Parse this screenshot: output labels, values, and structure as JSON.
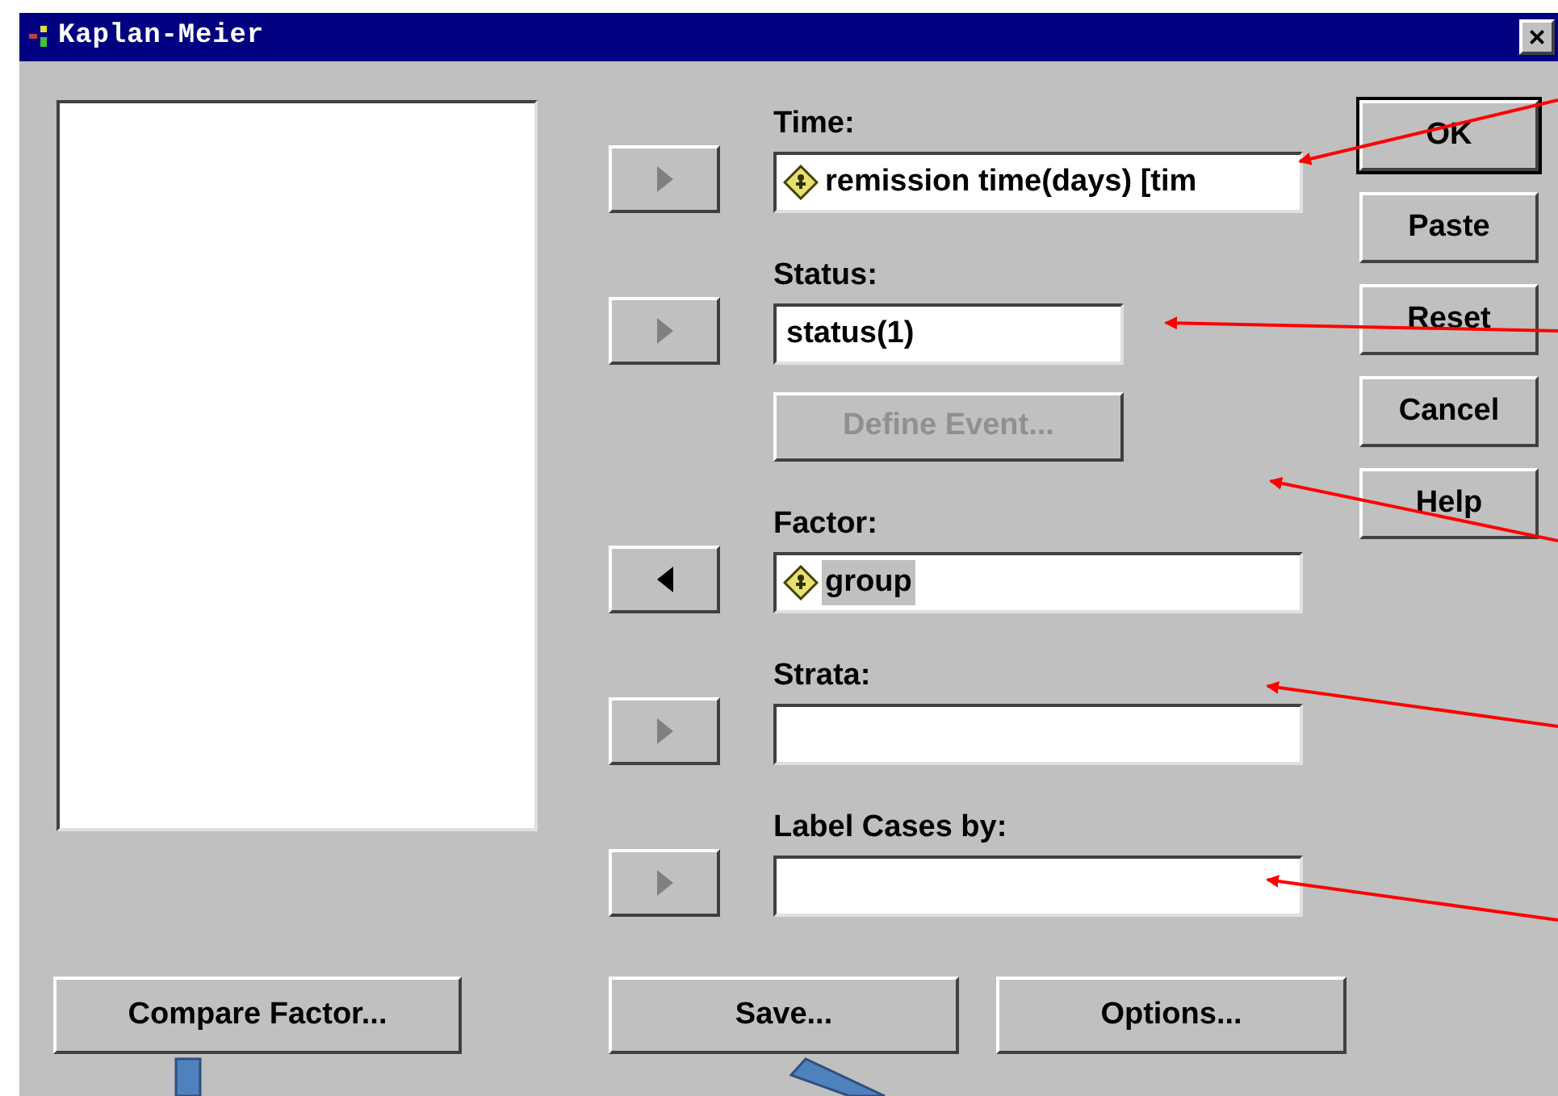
{
  "window": {
    "title": "Kaplan-Meier",
    "close": "×"
  },
  "rows": [
    {
      "kind": "field",
      "label": "Time:",
      "arrow": {
        "kind": "add",
        "disabled": true
      },
      "value": "remission time(days) [tim",
      "variable": true,
      "selected": false
    },
    {
      "kind": "short",
      "label": "Status:",
      "arrow": {
        "kind": "add",
        "disabled": true
      },
      "value": "status(1)",
      "variable": false,
      "selected": false
    },
    {
      "kind": "button",
      "label": "Define Event...",
      "disabled": true
    },
    {
      "kind": "field",
      "label": "Factor:",
      "arrow": {
        "kind": "remove",
        "disabled": false
      },
      "value": "group",
      "variable": true,
      "selected": true
    },
    {
      "kind": "field",
      "label": "Strata:",
      "arrow": {
        "kind": "add",
        "disabled": true
      }
    },
    {
      "kind": "field",
      "label": "Label Cases by:",
      "arrow": {
        "kind": "add",
        "disabled": true
      }
    }
  ],
  "side_buttons": [
    {
      "label": "OK",
      "default": true
    },
    {
      "label": "Paste",
      "default": false
    },
    {
      "label": "Reset",
      "default": false
    },
    {
      "label": "Cancel",
      "default": false
    },
    {
      "label": "Help",
      "default": false
    }
  ],
  "bottom_buttons": [
    {
      "label": "Compare Factor..."
    },
    {
      "label": "Save..."
    },
    {
      "label": "Options..."
    }
  ]
}
